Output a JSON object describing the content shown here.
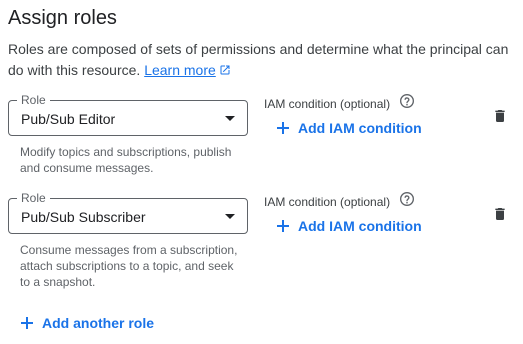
{
  "header": {
    "title": "Assign roles",
    "description": "Roles are composed of sets of permissions and determine what the principal can do with this resource.",
    "learn_more": "Learn more"
  },
  "roles": [
    {
      "field_label": "Role",
      "value": "Pub/Sub Editor",
      "hint": "Modify topics and subscriptions, publish and consume messages.",
      "iam_label": "IAM condition (optional)",
      "add_iam": "Add IAM condition"
    },
    {
      "field_label": "Role",
      "value": "Pub/Sub Subscriber",
      "hint": "Consume messages from a subscription, attach subscriptions to a topic, and seek to a snapshot.",
      "iam_label": "IAM condition (optional)",
      "add_iam": "Add IAM condition"
    }
  ],
  "add_role": "Add another role",
  "colors": {
    "accent": "#1a73e8",
    "text": "#202124",
    "muted": "#5f6368"
  },
  "icons": [
    "external-link-icon",
    "dropdown-arrow-icon",
    "help-icon",
    "plus-icon",
    "trash-icon"
  ]
}
